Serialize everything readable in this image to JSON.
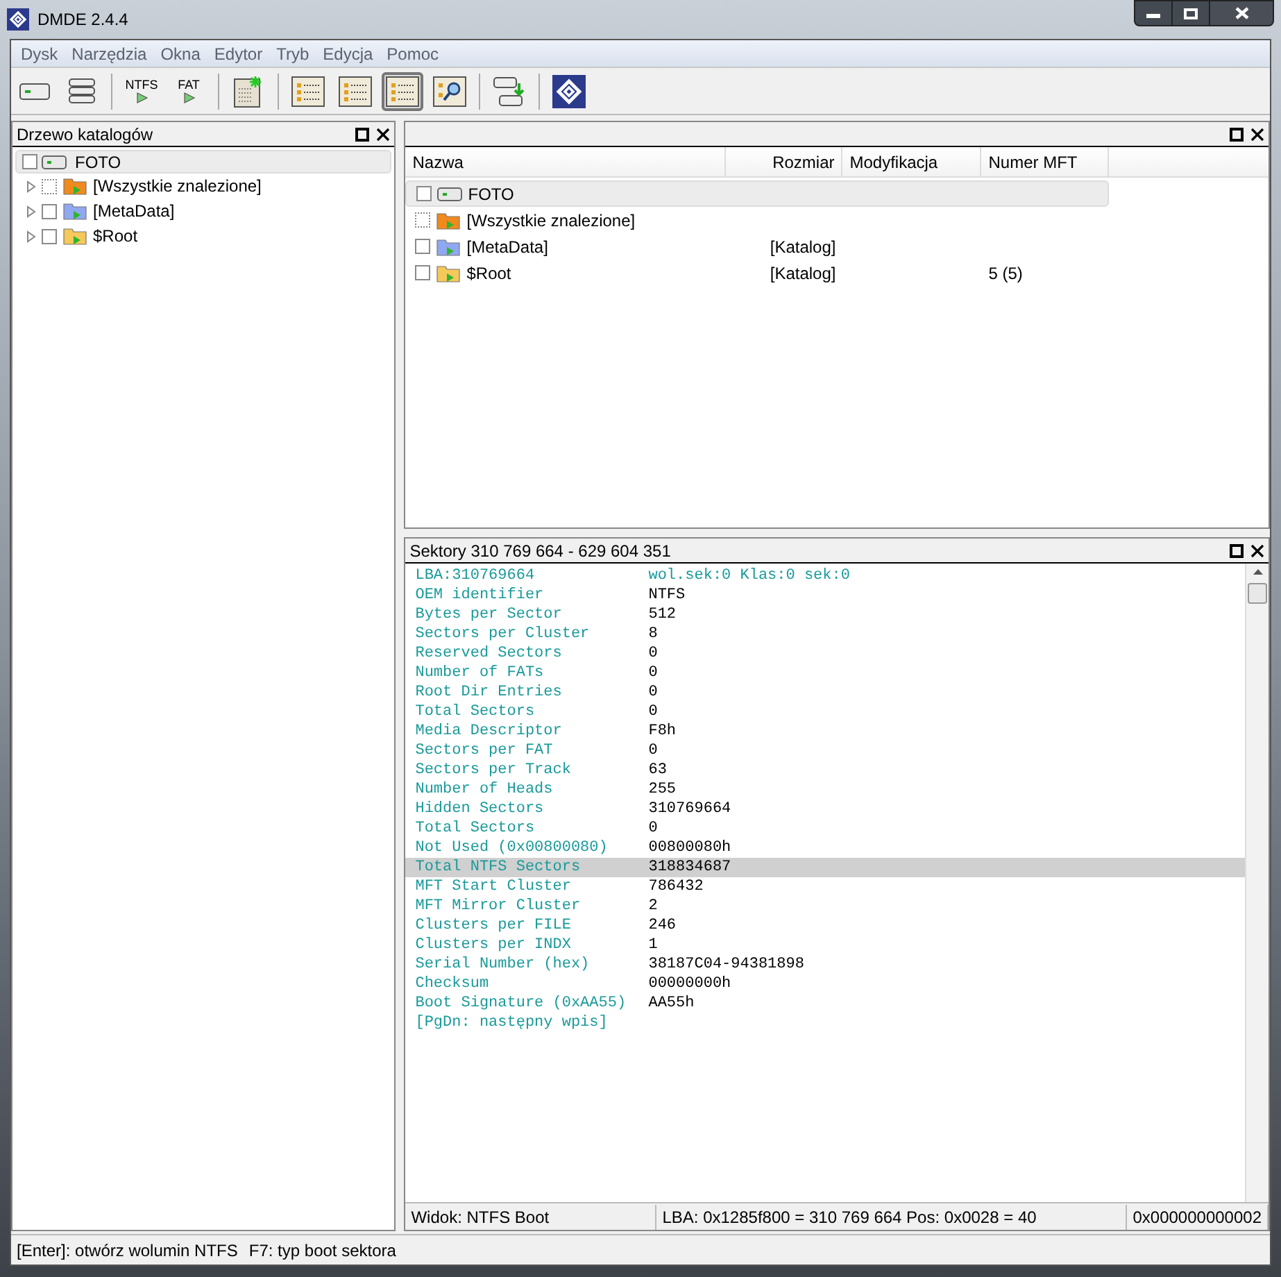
{
  "window": {
    "title": "DMDE 2.4.4"
  },
  "menu": [
    "Dysk",
    "Narzędzia",
    "Okna",
    "Edytor",
    "Tryb",
    "Edycja",
    "Pomoc"
  ],
  "toolbar": [
    {
      "kind": "icon",
      "selected": false
    },
    {
      "kind": "icon",
      "selected": false
    },
    {
      "kind": "separator"
    },
    {
      "kind": "text",
      "label": "NTFS",
      "selected": false
    },
    {
      "kind": "text",
      "label": "FAT",
      "selected": false
    },
    {
      "kind": "separator"
    },
    {
      "kind": "icon",
      "selected": false
    },
    {
      "kind": "separator"
    },
    {
      "kind": "icon",
      "selected": false
    },
    {
      "kind": "icon",
      "selected": false
    },
    {
      "kind": "icon",
      "selected": true
    },
    {
      "kind": "icon",
      "selected": false
    },
    {
      "kind": "separator"
    },
    {
      "kind": "icon",
      "selected": false
    },
    {
      "kind": "separator"
    },
    {
      "kind": "icon",
      "selected": false
    }
  ],
  "tree_panel": {
    "title": "Drzewo katalogów",
    "root": {
      "label": "FOTO",
      "checked": false,
      "selected": true,
      "children": [
        {
          "label": "[Wszystkie znalezione]",
          "kind": "virtual",
          "color": "#f08a1c",
          "checked": false,
          "expanded": false
        },
        {
          "label": "[MetaData]",
          "kind": "folder",
          "color": "#8fa8f0",
          "checked": false,
          "expanded": false
        },
        {
          "label": "$Root",
          "kind": "folder",
          "color": "#f5c85a",
          "checked": false,
          "expanded": false
        }
      ]
    }
  },
  "file_panel": {
    "columns": [
      "Nazwa",
      "Rozmiar",
      "Modyfikacja",
      "Numer MFT"
    ],
    "rows": [
      {
        "name": "FOTO",
        "kind": "drive",
        "selected": true,
        "checked": false
      },
      {
        "name": "[Wszystkie znalezione]",
        "kind": "virtual",
        "color": "#f08a1c",
        "selected": false,
        "checked": false
      },
      {
        "name": "[MetaData]",
        "kind": "folder",
        "color": "#8fa8f0",
        "size": "[Katalog]",
        "selected": false,
        "checked": false
      },
      {
        "name": "$Root",
        "kind": "folder",
        "color": "#f5c85a",
        "size": "[Katalog]",
        "mft": "5 (5)",
        "selected": false,
        "checked": false
      }
    ]
  },
  "sector_panel": {
    "title": "Sektory 310 769 664 - 629 604 351",
    "header": {
      "lba": "LBA:310769664",
      "position": "wol.sek:0 Klas:0 sek:0"
    },
    "fields": [
      {
        "label": "OEM identifier",
        "value": "NTFS",
        "selected": false
      },
      {
        "label": "Bytes per Sector",
        "value": "512",
        "selected": false
      },
      {
        "label": "Sectors per Cluster",
        "value": "8",
        "selected": false
      },
      {
        "label": "Reserved Sectors",
        "value": "0",
        "selected": false
      },
      {
        "label": "Number of FATs",
        "value": "0",
        "selected": false
      },
      {
        "label": "Root Dir Entries",
        "value": "0",
        "selected": false
      },
      {
        "label": "Total Sectors",
        "value": "0",
        "selected": false
      },
      {
        "label": "Media Descriptor",
        "value": "F8h",
        "selected": false
      },
      {
        "label": "Sectors per FAT",
        "value": "0",
        "selected": false
      },
      {
        "label": "Sectors per Track",
        "value": "63",
        "selected": false
      },
      {
        "label": "Number of Heads",
        "value": "255",
        "selected": false
      },
      {
        "label": "Hidden Sectors",
        "value": "310769664",
        "selected": false
      },
      {
        "label": "Total Sectors",
        "value": "0",
        "selected": false
      },
      {
        "label": "Not Used (0x00800080)",
        "value": "00800080h",
        "selected": false
      },
      {
        "label": "Total NTFS Sectors",
        "value": "318834687",
        "selected": true
      },
      {
        "label": "MFT Start Cluster",
        "value": "786432",
        "selected": false
      },
      {
        "label": "MFT Mirror Cluster",
        "value": "2",
        "selected": false
      },
      {
        "label": "Clusters per FILE",
        "value": "246",
        "selected": false
      },
      {
        "label": "Clusters per INDX",
        "value": "1",
        "selected": false
      },
      {
        "label": "Serial Number (hex)",
        "value": "38187C04-94381898",
        "selected": false
      },
      {
        "label": "Checksum",
        "value": "00000000h",
        "selected": false
      },
      {
        "label": "Boot Signature (0xAA55)",
        "value": "AA55h",
        "selected": false
      }
    ],
    "footer": "[PgDn: następny wpis]",
    "status": [
      "Widok: NTFS Boot",
      "LBA: 0x1285f800 = 310 769 664  Pos: 0x0028 = 40",
      "0x000000000002"
    ]
  },
  "status_bar": [
    "[Enter]: otwórz wolumin NTFS",
    "F7: typ boot sektora"
  ]
}
